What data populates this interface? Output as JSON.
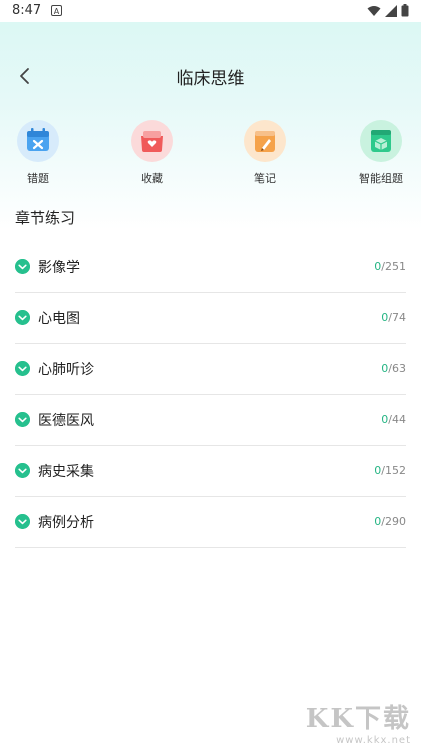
{
  "status_bar": {
    "time": "8:47",
    "notification_letter": "A"
  },
  "header": {
    "title": "临床思维"
  },
  "quick_actions": [
    {
      "label": "错题",
      "icon": "calendar-wrong-icon",
      "color": "#4aa3f0"
    },
    {
      "label": "收藏",
      "icon": "heart-box-icon",
      "color": "#f05a5a"
    },
    {
      "label": "笔记",
      "icon": "pen-note-icon",
      "color": "#f5a24a"
    },
    {
      "label": "智能组题",
      "icon": "cube-stack-icon",
      "color": "#2ec98c"
    }
  ],
  "section": {
    "title": "章节练习"
  },
  "chapters": [
    {
      "name": "影像学",
      "done": "0",
      "total": "/251"
    },
    {
      "name": "心电图",
      "done": "0",
      "total": "/74"
    },
    {
      "name": "心肺听诊",
      "done": "0",
      "total": "/63"
    },
    {
      "name": "医德医风",
      "done": "0",
      "total": "/44"
    },
    {
      "name": "病史采集",
      "done": "0",
      "total": "/152"
    },
    {
      "name": "病例分析",
      "done": "0",
      "total": "/290"
    }
  ],
  "watermark": {
    "logo": "KK下载",
    "url": "www.kkx.net"
  },
  "colors": {
    "accent": "#26c08e",
    "header_bg": "#dff8f5"
  }
}
